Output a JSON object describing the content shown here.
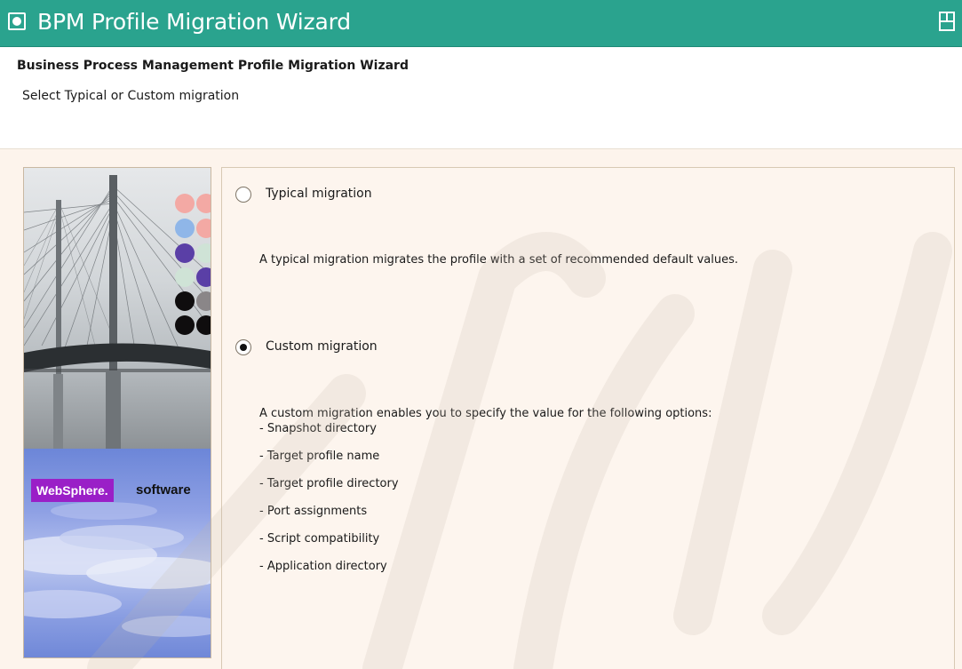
{
  "window": {
    "title": "BPM Profile Migration Wizard"
  },
  "header": {
    "title": "Business Process Management Profile Migration Wizard",
    "subtitle": "Select Typical or Custom migration"
  },
  "branding": {
    "badge": "WebSphere.",
    "word": "software",
    "badge_color": "#9a1fc7"
  },
  "options": {
    "typical": {
      "label": "Typical migration",
      "selected": false,
      "description": "A typical migration migrates the profile with a set of recommended default values."
    },
    "custom": {
      "label": "Custom migration",
      "selected": true,
      "description": "A custom migration enables you to specify the value for the following options:",
      "items": [
        "- Snapshot directory",
        "- Target profile name",
        "- Target profile directory",
        "- Port assignments",
        "- Script compatibility",
        "- Application directory"
      ]
    }
  },
  "colors": {
    "titlebar": "#2aa38e",
    "content_bg": "#fdf4ec"
  },
  "icons": {
    "window": "window-icon",
    "restore": "restore-window-icon"
  }
}
